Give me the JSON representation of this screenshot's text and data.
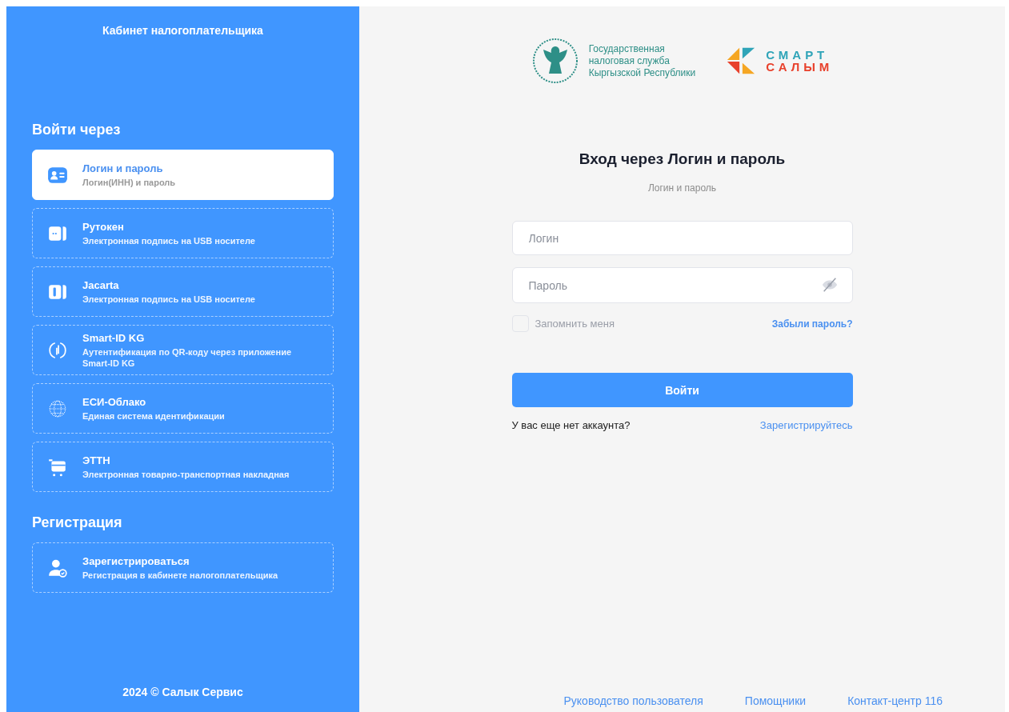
{
  "sidebar": {
    "title": "Кабинет налогоплательщика",
    "login_heading": "Войти через",
    "methods": [
      {
        "kind": "login",
        "title": "Логин и пароль",
        "subtitle": "Логин(ИНН) и пароль",
        "selected": true
      },
      {
        "kind": "rutoken",
        "title": "Рутокен",
        "subtitle": "Электронная подпись на USB носителе",
        "selected": false
      },
      {
        "kind": "jacarta",
        "title": "Jacarta",
        "subtitle": "Электронная подпись на USB носителе",
        "selected": false
      },
      {
        "kind": "smartid",
        "title": "Smart-ID KG",
        "subtitle": "Аутентификация по QR-коду через приложение Smart-ID KG",
        "selected": false
      },
      {
        "kind": "cloud",
        "title": "ЕСИ-Облако",
        "subtitle": "Единая система идентификации",
        "selected": false
      },
      {
        "kind": "ettn",
        "title": "ЭТТН",
        "subtitle": "Электронная товарно-транспортная накладная",
        "selected": false
      }
    ],
    "register_heading": "Регистрация",
    "register_items": [
      {
        "kind": "register",
        "title": "Зарегистрироваться",
        "subtitle": "Регистрация в кабинете налогоплательщика",
        "selected": false
      }
    ],
    "footer": "2024 © Салык Сервис"
  },
  "header": {
    "agency_name": [
      "Государственная",
      "налоговая служба",
      "Кыргызской Республики"
    ],
    "brand_lines": [
      "СМАРТ",
      "САЛЫМ"
    ]
  },
  "form": {
    "title": "Вход через Логин и пароль",
    "subtitle": "Логин и пароль",
    "login_field": {
      "placeholder": "Логин"
    },
    "password_field": {
      "placeholder": "Пароль"
    },
    "remember": {
      "label": "Запомнить меня",
      "checked": false
    },
    "forgot_link": "Забыли пароль?",
    "submit": "Войти",
    "no_account": "У вас еще нет аккаунта?",
    "register_link": "Зарегистрируйтесь"
  },
  "footer_links": [
    "Руководство пользователя",
    "Помощники",
    "Контакт-центр 116"
  ]
}
